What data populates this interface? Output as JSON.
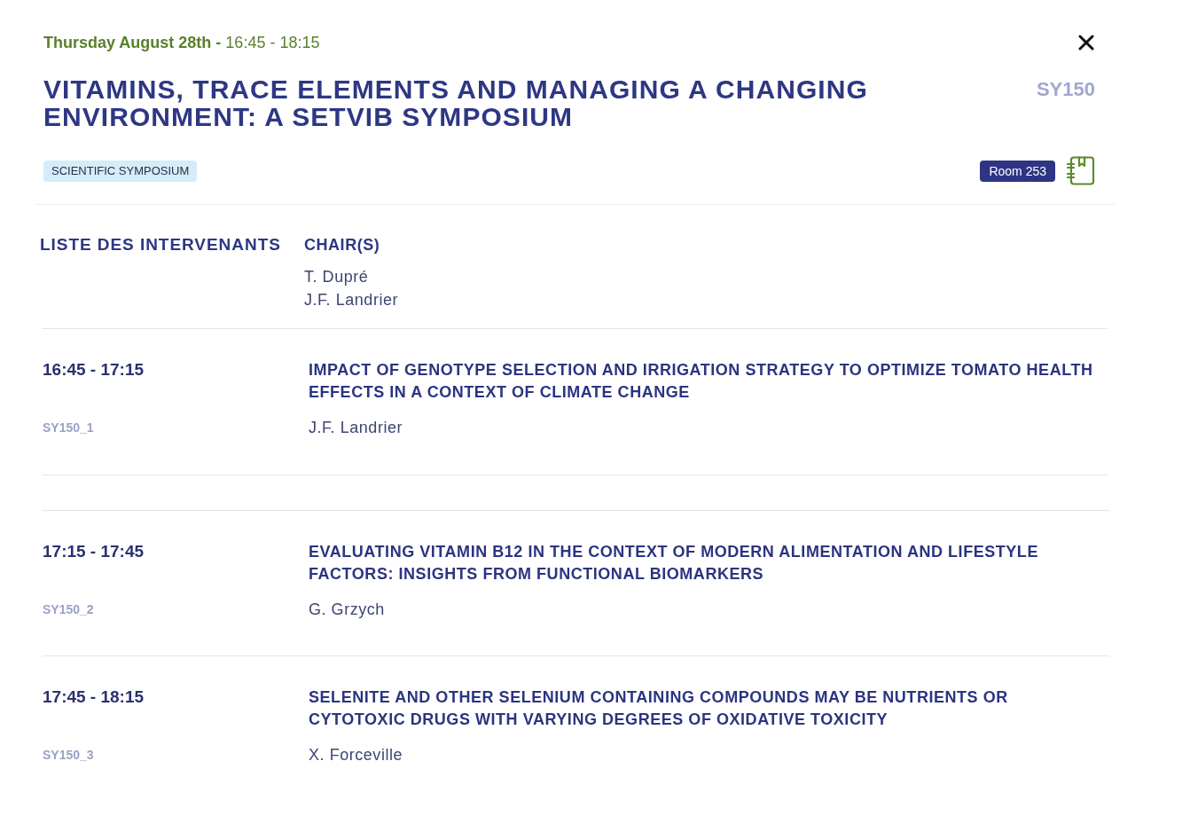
{
  "header": {
    "date": "**Thursday August 28th -** 16:45 - 18:15",
    "title": "VITAMINS, TRACE ELEMENTS AND MANAGING A CHANGING ENVIRONMENT: A SETVIB SYMPOSIUM",
    "code": "SY150",
    "tag": "SCIENTIFIC SYMPOSIUM",
    "room": "Room 253"
  },
  "speakers": {
    "heading": "LISTE DES INTERVENANTS",
    "chairs_label": "CHAIR(S)",
    "chairs": [
      "T. Dupré",
      "J.F. Landrier"
    ]
  },
  "sessions": [
    {
      "time": "16:45 - 17:15",
      "title": "IMPACT OF GENOTYPE SELECTION AND IRRIGATION STRATEGY TO OPTIMIZE TOMATO HEALTH EFFECTS IN A CONTEXT OF CLIMATE CHANGE",
      "code": "SY150_1",
      "speaker": "J.F. Landrier"
    },
    {
      "time": "17:15 - 17:45",
      "title": "EVALUATING VITAMIN B12 IN THE CONTEXT OF MODERN ALIMENTATION AND LIFESTYLE FACTORS: INSIGHTS FROM FUNCTIONAL BIOMARKERS",
      "code": "SY150_2",
      "speaker": "G. Grzych"
    },
    {
      "time": "17:45 - 18:15",
      "title": "SELENITE AND OTHER SELENIUM CONTAINING COMPOUNDS MAY BE NUTRIENTS OR CYTOTOXIC DRUGS WITH VARYING DEGREES OF OXIDATIVE TOXICITY",
      "code": "SY150_3",
      "speaker": "X. Forceville"
    }
  ]
}
